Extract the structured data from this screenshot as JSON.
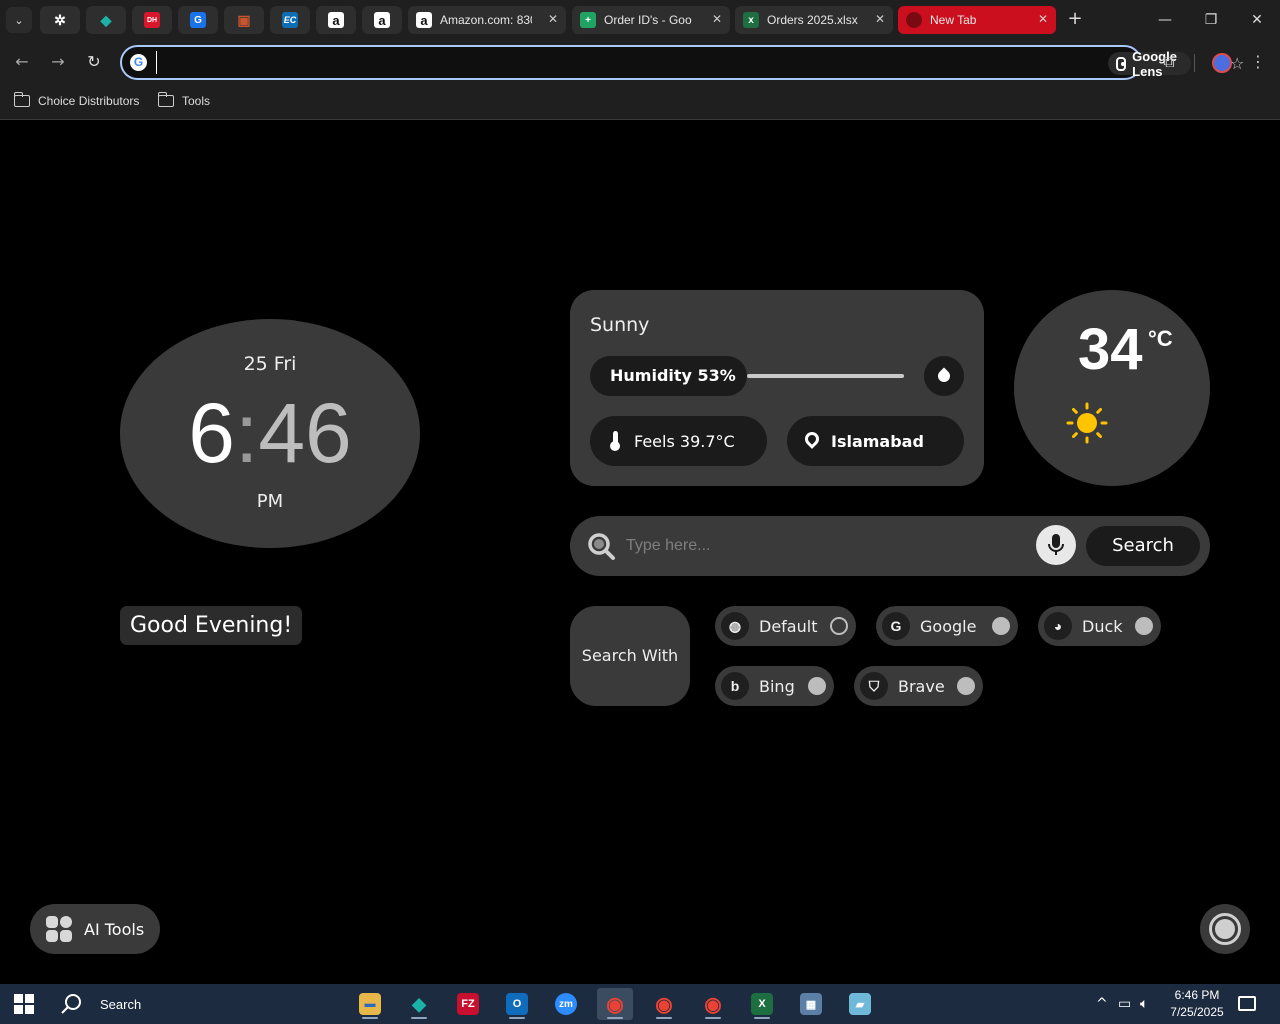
{
  "browser": {
    "tab_search_icon": "chevron-down-icon",
    "pinned_tabs": [
      {
        "icon": "openai-icon",
        "color": "#2e2e2e",
        "glyph": "✲"
      },
      {
        "icon": "gem-icon",
        "color": "#1bb3a8",
        "glyph": "◆"
      },
      {
        "icon": "dh-icon",
        "color": "#d8172b",
        "glyph": "DH"
      },
      {
        "icon": "g-blue-icon",
        "color": "#1a73e8",
        "glyph": "G"
      },
      {
        "icon": "box-icon",
        "color": "#c8552d",
        "glyph": "▣"
      },
      {
        "icon": "ec-icon",
        "color": "#0d6eb4",
        "glyph": "EC"
      },
      {
        "icon": "amazon-icon",
        "color": "#ffffff",
        "glyph": "a"
      },
      {
        "icon": "amazon-icon",
        "color": "#ffffff",
        "glyph": "a"
      }
    ],
    "tabs": [
      {
        "title": "Amazon.com: 830",
        "icon": "amazon-icon",
        "color": "#ffffff",
        "glyph": "a"
      },
      {
        "title": "Order ID's - Goo",
        "icon": "sheets-icon",
        "color": "#1fa463",
        "glyph": "+"
      },
      {
        "title": "Orders 2025.xlsx",
        "icon": "excel-icon",
        "color": "#1d6f42",
        "glyph": "x"
      },
      {
        "title": "New Tab",
        "icon": "newtab-icon",
        "color": "#7a0a12",
        "glyph": ""
      }
    ],
    "window_controls": {
      "minimize": "—",
      "restore": "❐",
      "close": "✕"
    },
    "omnibox": {
      "value": "",
      "lens_label": "Google Lens"
    },
    "bookmarks": [
      "Choice Distributors",
      "Tools"
    ]
  },
  "clock": {
    "date": "25 Fri",
    "hour": "6",
    "colon": ":",
    "minute": "46",
    "ampm": "PM"
  },
  "greeting": "Good Evening!",
  "weather": {
    "condition": "Sunny",
    "humidity_label": "Humidity 53%",
    "humidity": 53,
    "feels_label": "Feels 39.7°C",
    "location": "Islamabad",
    "temperature": "34",
    "unit": "°C",
    "icon": "sun-icon"
  },
  "search": {
    "placeholder": "Type here...",
    "button_label": "Search",
    "search_with_label": "Search With",
    "engines": [
      {
        "name": "Default",
        "icon": "globe-icon",
        "glyph": "◍",
        "selected": true
      },
      {
        "name": "Google",
        "icon": "google-icon",
        "glyph": "G",
        "selected": false
      },
      {
        "name": "Duck",
        "icon": "duck-icon",
        "glyph": "◕",
        "selected": false
      },
      {
        "name": "Bing",
        "icon": "bing-icon",
        "glyph": "b",
        "selected": false
      },
      {
        "name": "Brave",
        "icon": "brave-icon",
        "glyph": "⛉",
        "selected": false
      }
    ]
  },
  "ai_tools_label": "AI Tools",
  "taskbar": {
    "search_label": "Search",
    "apps": [
      {
        "icon": "file-explorer-icon",
        "color": "#e8b74a",
        "glyph": "▬"
      },
      {
        "icon": "gem-icon",
        "color": "#1bb3a8",
        "glyph": "◆"
      },
      {
        "icon": "filezilla-icon",
        "color": "#c8102e",
        "glyph": "FZ"
      },
      {
        "icon": "outlook-icon",
        "color": "#0f6cbd",
        "glyph": "O"
      },
      {
        "icon": "zoom-icon",
        "color": "#2d8cff",
        "glyph": "zm"
      },
      {
        "icon": "chrome-icon",
        "color": "#ea4335",
        "glyph": "◉"
      },
      {
        "icon": "chrome-icon",
        "color": "#ea4335",
        "glyph": "◉"
      },
      {
        "icon": "chrome-icon",
        "color": "#ea4335",
        "glyph": "◉"
      },
      {
        "icon": "excel-icon",
        "color": "#1d6f42",
        "glyph": "X"
      },
      {
        "icon": "calculator-icon",
        "color": "#5b7fa6",
        "glyph": "▦"
      },
      {
        "icon": "notepad-icon",
        "color": "#6fb9d8",
        "glyph": "▰"
      }
    ],
    "time": "6:46 PM",
    "date": "7/25/2025"
  }
}
